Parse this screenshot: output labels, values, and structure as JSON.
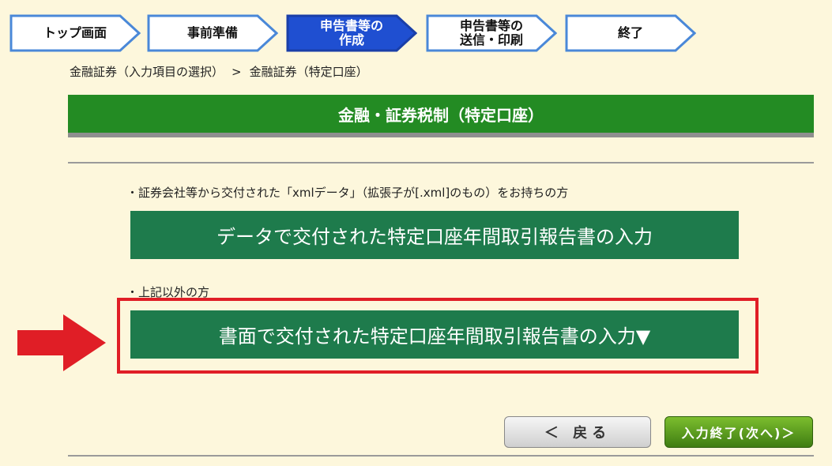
{
  "steps": [
    {
      "label": "トップ画面",
      "active": false
    },
    {
      "label": "事前準備",
      "active": false
    },
    {
      "label": "申告書等の\n作成",
      "active": true
    },
    {
      "label": "申告書等の\n送信・印刷",
      "active": false
    },
    {
      "label": "終了",
      "active": false
    }
  ],
  "breadcrumb": {
    "parent": "金融証券（入力項目の選択）",
    "separator": ">",
    "current": "金融証券（特定口座）"
  },
  "section": {
    "title": "金融・証券税制（特定口座）"
  },
  "options": [
    {
      "note": "・証券会社等から交付された「xmlデータ」（拡張子が[.xml]のもの）をお持ちの方",
      "button_label": "データで交付された特定口座年間取引報告書の入力"
    },
    {
      "note": "・上記以外の方",
      "button_label": "書面で交付された特定口座年間取引報告書の入力▼"
    }
  ],
  "nav": {
    "back_label": "＜ 戻る",
    "next_label": "入力終了(次へ)＞"
  },
  "colors": {
    "background": "#fdf7dc",
    "section_green": "#238b23",
    "option_green": "#1e7b4c",
    "step_active": "#1f4fd1",
    "step_border": "#4a88d8",
    "highlight_red": "#e01e26"
  }
}
